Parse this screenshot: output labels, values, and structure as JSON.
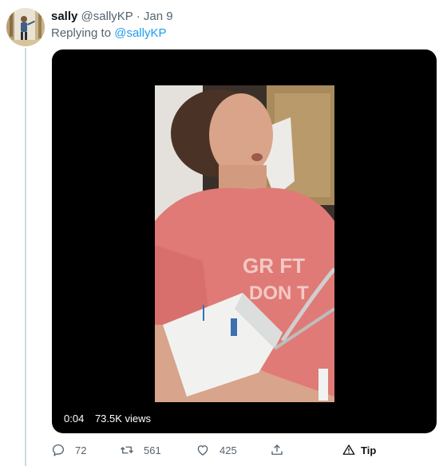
{
  "tweet": {
    "display_name": "sally",
    "handle": "@sallyKP",
    "separator": "·",
    "date": "Jan 9",
    "replying_prefix": "Replying to",
    "replying_handle": "@sallyKP"
  },
  "media": {
    "time": "0:04",
    "views": "73.5K views",
    "shirt_text": [
      "GR FT",
      "DON T"
    ]
  },
  "actions": {
    "reply_count": "72",
    "retweet_count": "561",
    "like_count": "425",
    "tip_label": "Tip"
  },
  "icons": {
    "reply": "reply-icon",
    "retweet": "retweet-icon",
    "like": "heart-icon",
    "share": "share-icon",
    "tip": "tip-icon"
  },
  "colors": {
    "link": "#1d9bf0",
    "secondary_text": "#536471",
    "thread_line": "#cfd9de",
    "video_bg": "#000000"
  }
}
